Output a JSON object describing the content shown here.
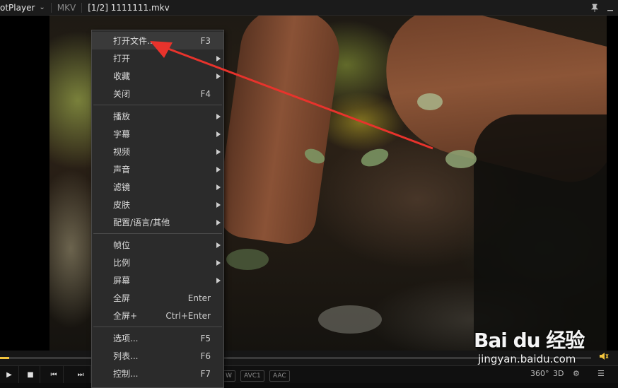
{
  "titlebar": {
    "app_name": "otPlayer",
    "format": "MKV",
    "filename": "[1/2] 1111111.mkv"
  },
  "menu": {
    "groups": [
      [
        {
          "label": "打开文件...",
          "shortcut": "F3",
          "submenu": false
        },
        {
          "label": "打开",
          "shortcut": "",
          "submenu": true
        },
        {
          "label": "收藏",
          "shortcut": "",
          "submenu": true
        },
        {
          "label": "关闭",
          "shortcut": "F4",
          "submenu": false
        }
      ],
      [
        {
          "label": "播放",
          "shortcut": "",
          "submenu": true
        },
        {
          "label": "字幕",
          "shortcut": "",
          "submenu": true
        },
        {
          "label": "视频",
          "shortcut": "",
          "submenu": true
        },
        {
          "label": "声音",
          "shortcut": "",
          "submenu": true
        },
        {
          "label": "滤镜",
          "shortcut": "",
          "submenu": true
        },
        {
          "label": "皮肤",
          "shortcut": "",
          "submenu": true
        },
        {
          "label": "配置/语言/其他",
          "shortcut": "",
          "submenu": true
        }
      ],
      [
        {
          "label": "帧位",
          "shortcut": "",
          "submenu": true
        },
        {
          "label": "比例",
          "shortcut": "",
          "submenu": true
        },
        {
          "label": "屏幕",
          "shortcut": "",
          "submenu": true
        },
        {
          "label": "全屏",
          "shortcut": "Enter",
          "submenu": false
        },
        {
          "label": "全屏+",
          "shortcut": "Ctrl+Enter",
          "submenu": false
        }
      ],
      [
        {
          "label": "选项...",
          "shortcut": "F5",
          "submenu": false
        },
        {
          "label": "列表...",
          "shortcut": "F6",
          "submenu": false
        },
        {
          "label": "控制...",
          "shortcut": "F7",
          "submenu": false
        }
      ]
    ]
  },
  "controls": {
    "codecs": [
      "W",
      "AVC1",
      "AAC"
    ],
    "right": {
      "vr": "360°",
      "threed": "3D"
    },
    "progress": 0.015
  },
  "watermark": {
    "logo": "Bai du 经验",
    "url": "jingyan.baidu.com"
  },
  "colors": {
    "accent": "#f2c43d",
    "arrow": "#e8332c",
    "menu_bg": "#2b2b2b"
  }
}
